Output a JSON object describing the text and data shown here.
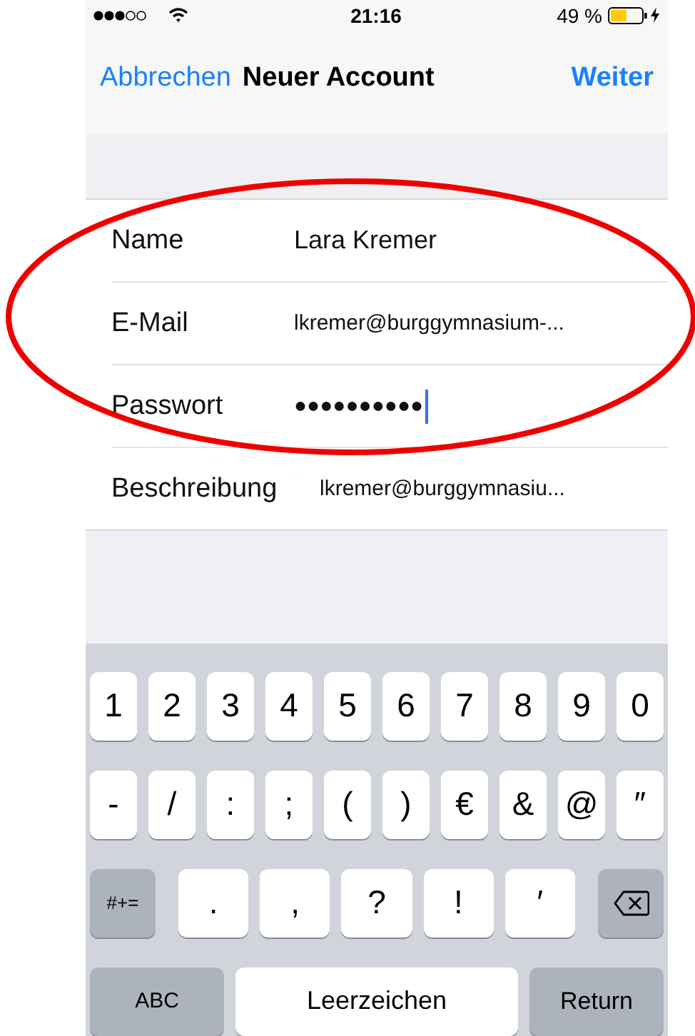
{
  "status_bar": {
    "time": "21:16",
    "battery_text": "49 %"
  },
  "nav_bar": {
    "cancel": "Abbrechen",
    "title": "Neuer Account",
    "next": "Weiter"
  },
  "form": {
    "rows": [
      {
        "label": "Name",
        "value": "Lara Kremer",
        "kind": "text",
        "focused": false
      },
      {
        "label": "E-Mail",
        "value": "lkremer@burggymnasium-...",
        "kind": "small",
        "focused": false
      },
      {
        "label": "Passwort",
        "value": "●●●●●●●●●●",
        "kind": "password",
        "focused": true
      },
      {
        "label": "Beschreibung",
        "value": "lkremer@burggymnasiu...",
        "kind": "small",
        "focused": false
      }
    ]
  },
  "keyboard": {
    "rows": [
      {
        "keys": [
          {
            "kind": "char",
            "label": "1"
          },
          {
            "kind": "char",
            "label": "2"
          },
          {
            "kind": "char",
            "label": "3"
          },
          {
            "kind": "char",
            "label": "4"
          },
          {
            "kind": "char",
            "label": "5"
          },
          {
            "kind": "char",
            "label": "6"
          },
          {
            "kind": "char",
            "label": "7"
          },
          {
            "kind": "char",
            "label": "8"
          },
          {
            "kind": "char",
            "label": "9"
          },
          {
            "kind": "char",
            "label": "0"
          }
        ]
      },
      {
        "keys": [
          {
            "kind": "char",
            "label": "-"
          },
          {
            "kind": "char",
            "label": "/"
          },
          {
            "kind": "char",
            "label": ":"
          },
          {
            "kind": "char",
            "label": ";"
          },
          {
            "kind": "char",
            "label": "("
          },
          {
            "kind": "char",
            "label": ")"
          },
          {
            "kind": "char",
            "label": "€"
          },
          {
            "kind": "char",
            "label": "&"
          },
          {
            "kind": "char",
            "label": "@"
          },
          {
            "kind": "char",
            "label": "″"
          }
        ]
      },
      {
        "keys": [
          {
            "kind": "function",
            "label": "#+="
          },
          {
            "kind": "wide",
            "label": "."
          },
          {
            "kind": "wide",
            "label": ","
          },
          {
            "kind": "wide",
            "label": "?"
          },
          {
            "kind": "wide",
            "label": "!"
          },
          {
            "kind": "wide",
            "label": "′"
          },
          {
            "kind": "delete"
          }
        ]
      },
      {
        "keys": [
          {
            "kind": "bottom",
            "label": "ABC"
          },
          {
            "kind": "space",
            "label": "Leerzeichen"
          },
          {
            "kind": "bottom",
            "label": "Return"
          }
        ]
      }
    ]
  },
  "annotations": [
    {
      "kind": "ellipse"
    }
  ]
}
